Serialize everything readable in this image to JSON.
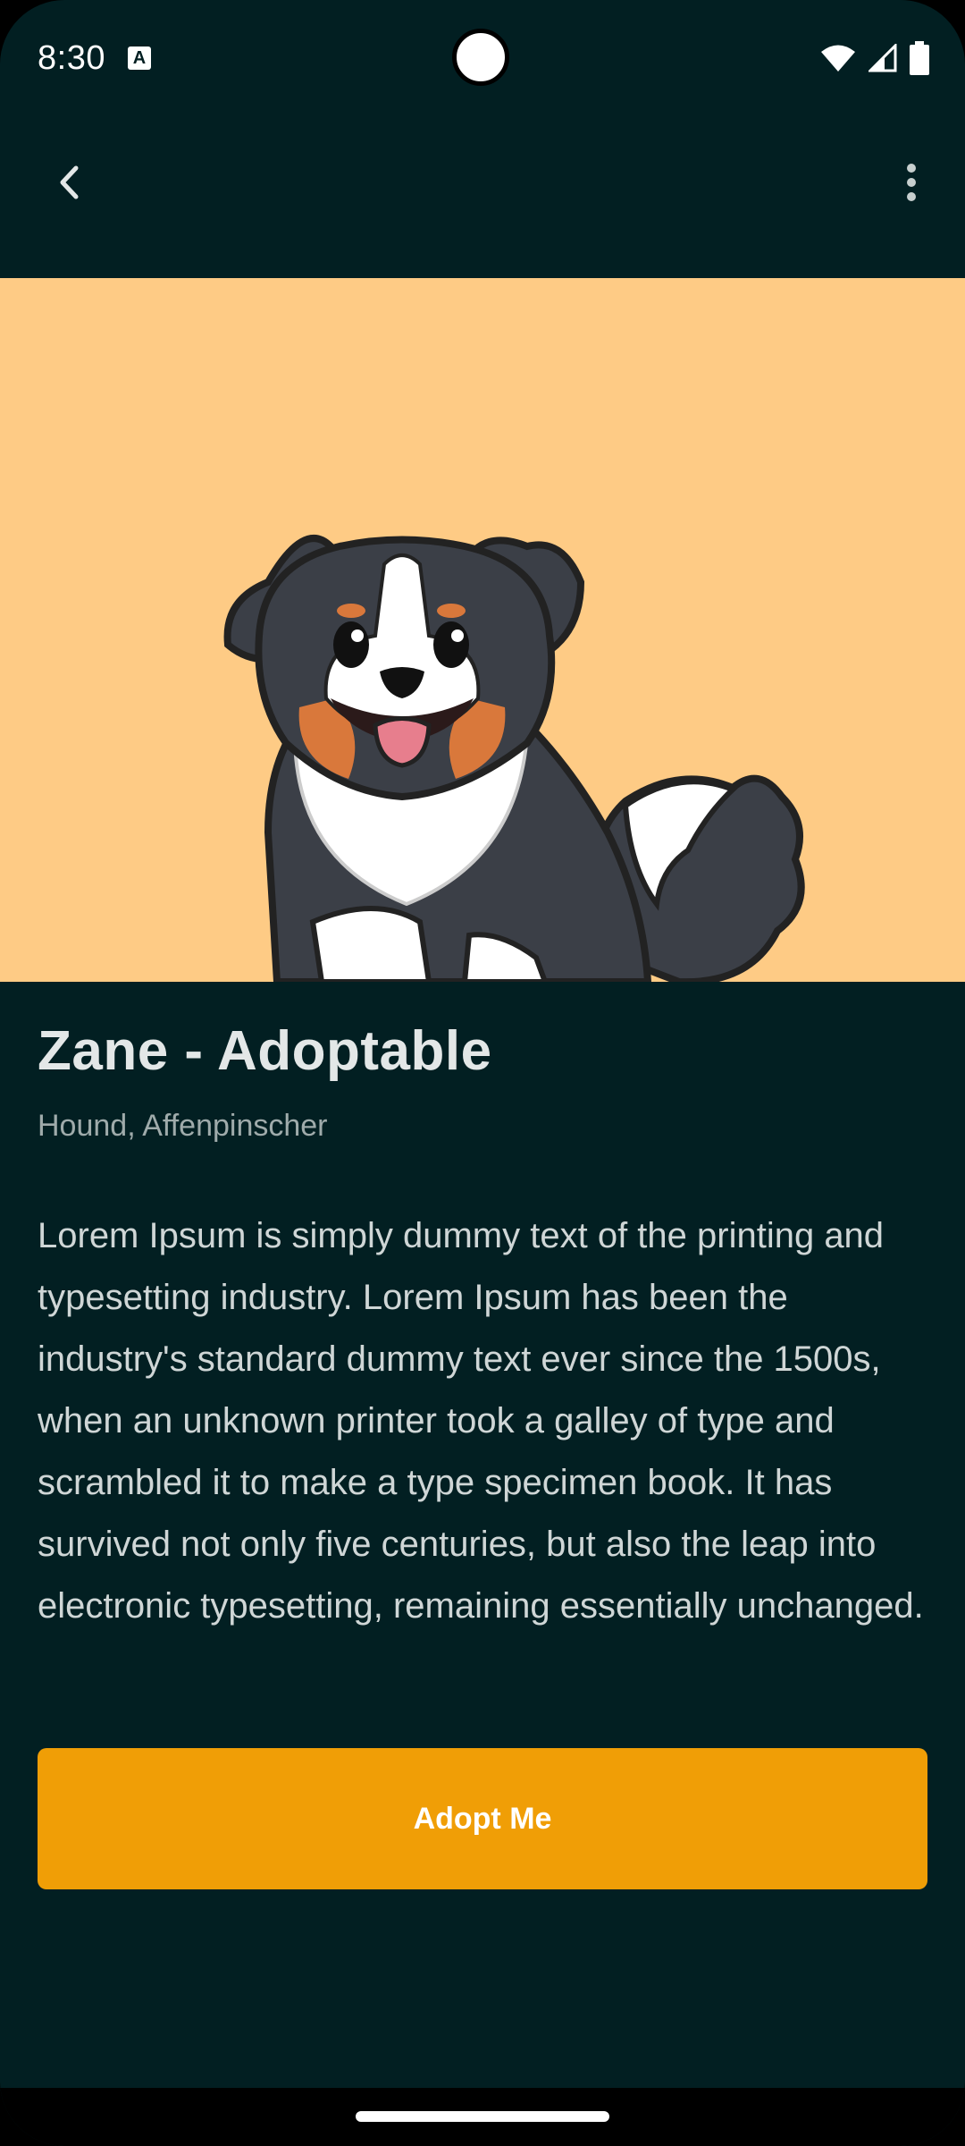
{
  "status_bar": {
    "time": "8:30",
    "notification_icon": "a-letter-icon",
    "wifi_icon": "wifi-icon",
    "signal_icon": "cell-signal-icon",
    "battery_icon": "battery-icon"
  },
  "app_bar": {
    "back_icon": "chevron-left-icon",
    "more_icon": "more-vertical-icon"
  },
  "hero": {
    "background": "#fecb85",
    "image": "cartoon-dog-illustration"
  },
  "pet": {
    "title": "Zane - Adoptable",
    "breeds": "Hound, Affenpinscher",
    "description": "Lorem Ipsum is simply dummy text of the printing and typesetting industry. Lorem Ipsum has been the industry's standard dummy text ever since the 1500s, when an unknown printer took a galley of type and scrambled it to make a type specimen book. It has survived not only five centuries, but also the leap into electronic typesetting, remaining essentially unchanged."
  },
  "actions": {
    "adopt_label": "Adopt Me"
  },
  "colors": {
    "background": "#021f22",
    "accent": "#f09e06"
  }
}
